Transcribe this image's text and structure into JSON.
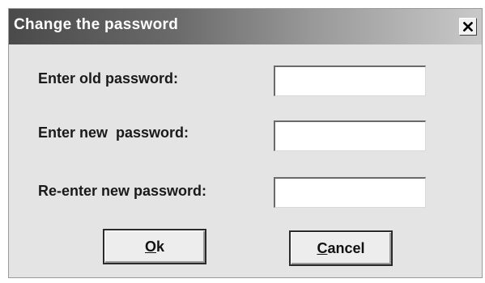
{
  "window": {
    "title": "Change the password",
    "close_icon": "close-icon"
  },
  "fields": [
    {
      "label": "Enter old password:",
      "value": "",
      "placeholder": ""
    },
    {
      "label": "Enter new  password:",
      "value": "",
      "placeholder": ""
    },
    {
      "label": "Re-enter new password:",
      "value": "",
      "placeholder": ""
    }
  ],
  "buttons": {
    "ok": {
      "mnemonic": "O",
      "rest": "k"
    },
    "cancel": {
      "mnemonic": "C",
      "rest": "ancel"
    }
  }
}
